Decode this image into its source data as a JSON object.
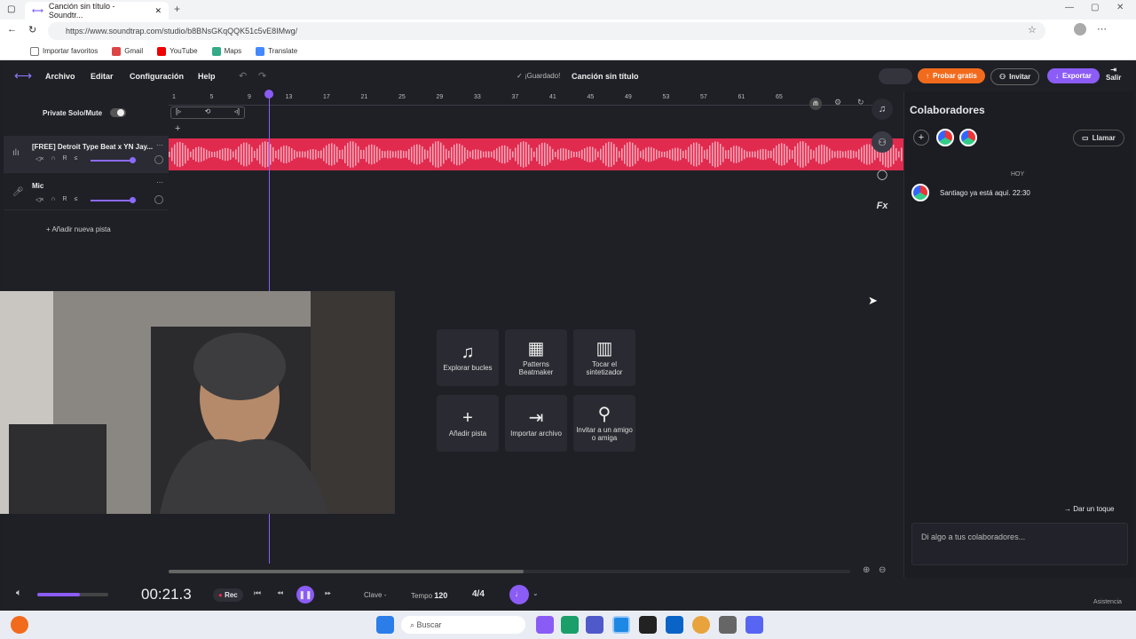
{
  "browser": {
    "tab_title": "Canción sin título - Soundtr...",
    "url": "https://www.soundtrap.com/studio/b8BNsGKqQQK51c5vE8IMwg/",
    "bookmarks": [
      "Importar favoritos",
      "Gmail",
      "YouTube",
      "Maps",
      "Translate"
    ]
  },
  "menu": {
    "items": [
      "Archivo",
      "Editar",
      "Configuración",
      "Help"
    ],
    "save_status": "¡Guardado!",
    "song_title": "Canción sin título",
    "try_free": "Probar gratis",
    "invite": "Invitar",
    "export": "Exportar",
    "exit": "Salir"
  },
  "tracks": {
    "solo_mute_label": "Private Solo/Mute",
    "list": [
      {
        "name": "[FREE] Detroit Type Beat x YN Jay...",
        "controls": [
          "◁×",
          "∩",
          "R",
          "≤"
        ]
      },
      {
        "name": "Mic",
        "controls": [
          "◁×",
          "∩",
          "R",
          "≤"
        ]
      }
    ],
    "add_track": "Añadir nueva pista"
  },
  "ruler": [
    "1",
    "5",
    "9",
    "13",
    "17",
    "21",
    "25",
    "29",
    "33",
    "37",
    "41",
    "45",
    "49",
    "53",
    "57",
    "61",
    "65"
  ],
  "tiles": [
    {
      "label": "Explorar bucles",
      "icon": "music-note-icon"
    },
    {
      "label": "Patterns Beatmaker",
      "icon": "grid-icon"
    },
    {
      "label": "Tocar el sintetizador",
      "icon": "piano-icon"
    },
    {
      "label": "Añadir pista",
      "icon": "plus-icon"
    },
    {
      "label": "Importar archivo",
      "icon": "import-icon"
    },
    {
      "label": "Invitar a un amigo o amiga",
      "icon": "add-person-icon"
    }
  ],
  "collab": {
    "title": "Colaboradores",
    "call": "Llamar",
    "day": "HOY",
    "message": "Santiago ya está aquí. 22:30",
    "nudge": "Dar un toque",
    "chat_placeholder": "Di algo a tus colaboradores..."
  },
  "transport": {
    "time": "00:21.3",
    "rec": "Rec",
    "key_label": "Clave",
    "key_value": "-",
    "tempo_label": "Tempo",
    "tempo_value": "120",
    "signature": "4/4",
    "volume_level": 0.6
  },
  "footer": {
    "assist": "Asistencia"
  },
  "taskbar": {
    "search": "Buscar"
  },
  "colors": {
    "accent": "#8b5cf6",
    "waveform": "#e02b4f",
    "try_free": "#f26b1d",
    "export": "#8b5cf6"
  }
}
